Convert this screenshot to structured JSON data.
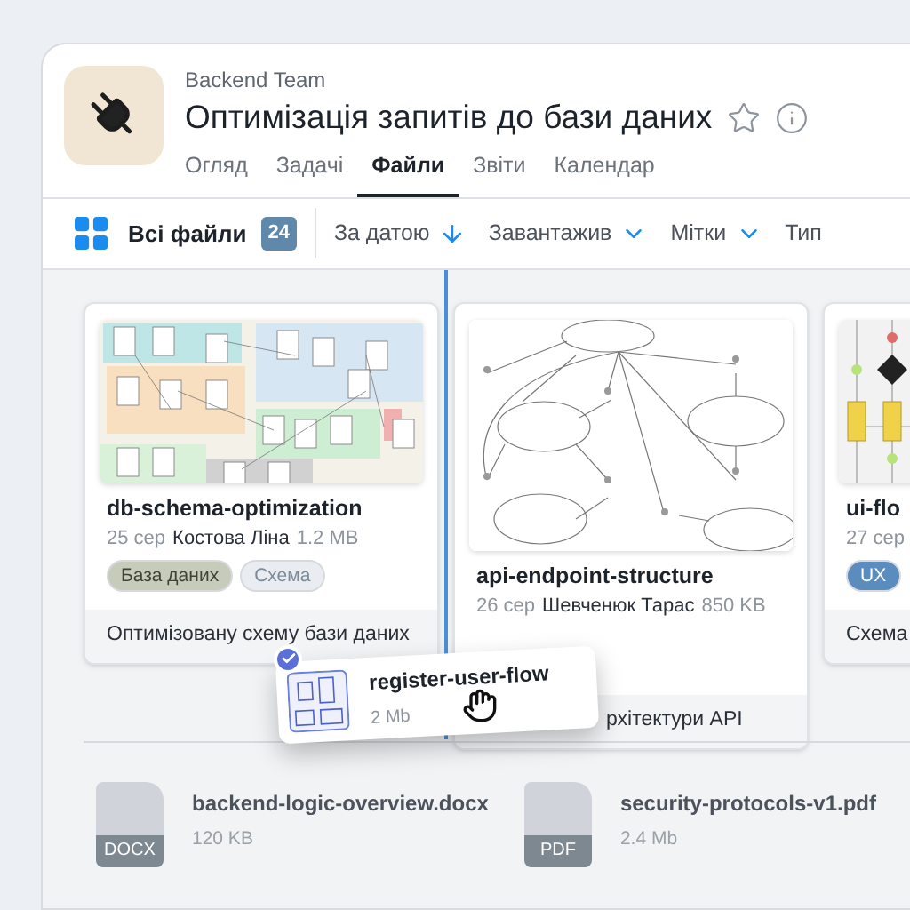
{
  "header": {
    "team": "Backend Team",
    "title": "Оптимізація запитів до бази даних",
    "starred": false
  },
  "tabs": [
    {
      "label": "Огляд",
      "selected": false
    },
    {
      "label": "Задачі",
      "selected": false
    },
    {
      "label": "Файли",
      "selected": true
    },
    {
      "label": "Звіти",
      "selected": false
    },
    {
      "label": "Календар",
      "selected": false
    }
  ],
  "toolbar": {
    "all_files": "Всі файли",
    "count": "24",
    "filters": [
      {
        "label": "За датою",
        "kind": "sort"
      },
      {
        "label": "Завантажив",
        "kind": "dropdown"
      },
      {
        "label": "Мітки",
        "kind": "dropdown"
      },
      {
        "label": "Тип",
        "kind": "plain"
      }
    ]
  },
  "cards": [
    {
      "kind": "schema",
      "name": "db-schema-optimization",
      "date": "25 сер",
      "author": "Костова Ліна",
      "size": "1.2 MB",
      "tags": [
        {
          "label": "База даних",
          "color": "#c6ccb9"
        },
        {
          "label": "Схема",
          "color": "#e9edf1"
        }
      ],
      "description": "Оптимізовану схему бази даних"
    },
    {
      "kind": "usecase",
      "name": "api-endpoint-structure",
      "date": "26 сер",
      "author": "Шевченюк Тарас",
      "size": "850 KB",
      "description": "рхітектури API"
    },
    {
      "kind": "flow",
      "name": "ui-flo",
      "date": "27 сер",
      "tags": [
        {
          "label": "UX",
          "color": "#5b8cbe"
        }
      ],
      "description": "Схема"
    }
  ],
  "dragged": {
    "name": "register-user-flow",
    "size": "2 Mb",
    "selected": true
  },
  "files": [
    {
      "name": "backend-logic-overview.docx",
      "type": "DOCX",
      "size": "120 KB"
    },
    {
      "name": "security-protocols-v1.pdf",
      "type": "PDF",
      "size": "2.4 Mb"
    }
  ]
}
